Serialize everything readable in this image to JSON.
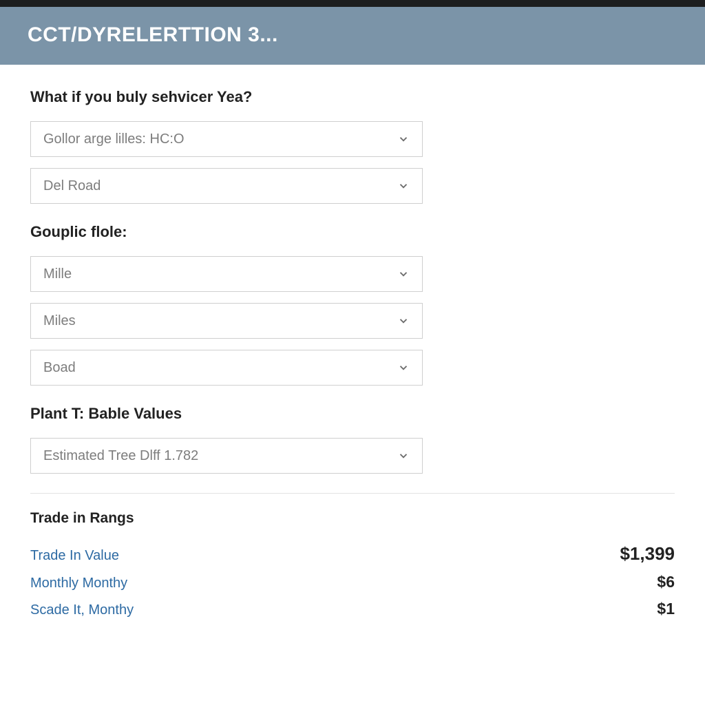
{
  "header": {
    "title": "CCT/DYRELERTTION 3..."
  },
  "sections": {
    "q1": {
      "label": "What if you buly sehvicer Yea?",
      "options": [
        "Gollor arge lilles: HC:O",
        "Del Road"
      ]
    },
    "q2": {
      "label": "Gouplic flole:",
      "options": [
        "Mille",
        "Miles",
        "Boad"
      ]
    },
    "q3": {
      "label": "Plant T: Bable Values",
      "options": [
        "Estimated Tree Dlff 1.782"
      ]
    }
  },
  "results": {
    "title": "Trade in Rangs",
    "rows": [
      {
        "label": "Trade In Value",
        "value": "$1,399"
      },
      {
        "label": "Monthly Monthy",
        "value": "$6"
      },
      {
        "label": "Scade It, Monthy",
        "value": "$1"
      }
    ]
  }
}
